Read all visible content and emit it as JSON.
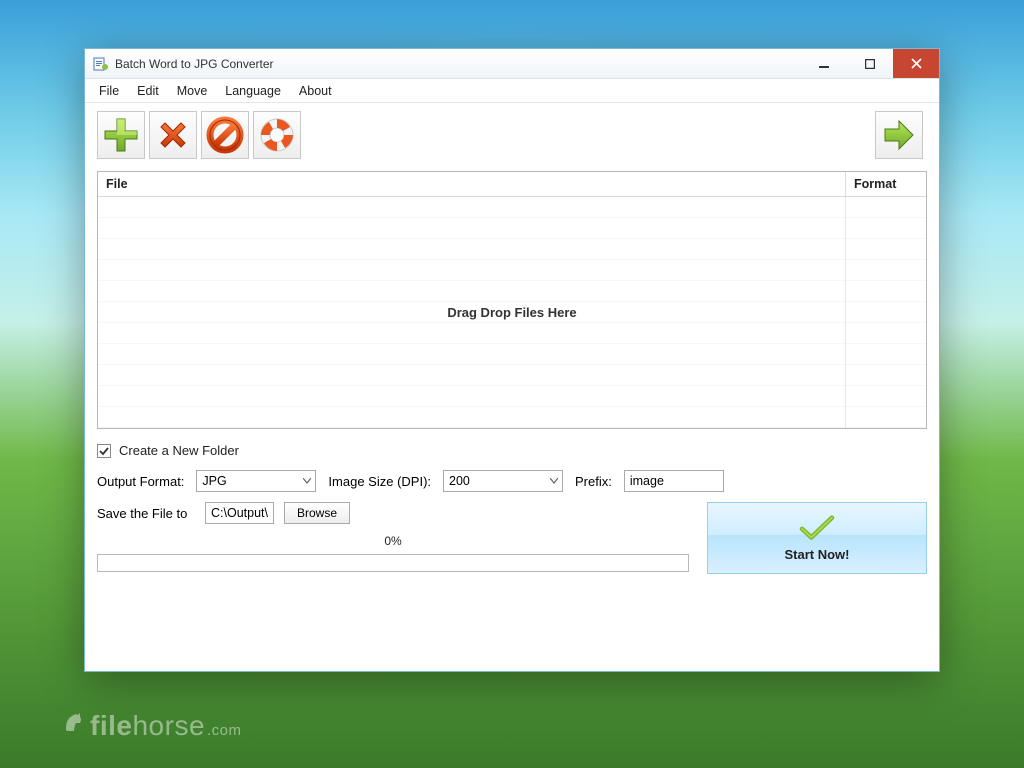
{
  "titlebar": {
    "title": "Batch Word to JPG Converter"
  },
  "menu": {
    "file": "File",
    "edit": "Edit",
    "move": "Move",
    "language": "Language",
    "about": "About"
  },
  "toolbar": {
    "add": "add-icon",
    "remove": "remove-icon",
    "clear": "clear-icon",
    "help": "help-icon",
    "next": "next-icon"
  },
  "table": {
    "col_file": "File",
    "col_format": "Format",
    "drag_msg": "Drag  Drop Files Here"
  },
  "options": {
    "create_folder_label": "Create a New Folder",
    "create_folder_checked": true,
    "output_format_label": "Output Format:",
    "output_format_value": "JPG",
    "dpi_label": "Image Size (DPI):",
    "dpi_value": "200",
    "prefix_label": "Prefix:",
    "prefix_value": "image",
    "save_to_label": "Save the File to",
    "save_to_value": "C:\\Output\\",
    "browse_label": "Browse",
    "progress_label": "0%",
    "start_label": "Start Now!"
  },
  "watermark": {
    "brand_bold": "file",
    "brand_rest": "horse",
    "tld": ".com"
  }
}
